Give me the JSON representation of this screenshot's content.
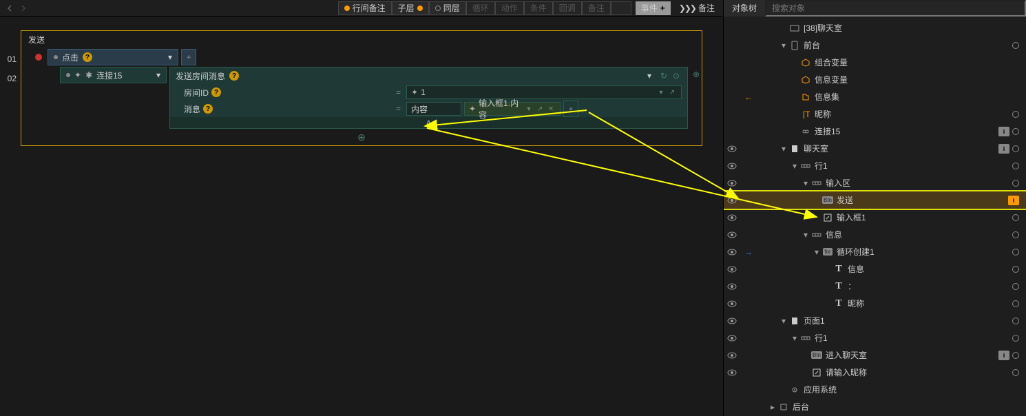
{
  "topbar": {
    "line_remark": "行间备注",
    "child_layer": "子层",
    "same_layer": "同层",
    "filters": [
      "循环",
      "动作",
      "条件",
      "回调",
      "备注"
    ],
    "event": "事件",
    "remark": "备注"
  },
  "event": {
    "title": "发送",
    "line1": "01",
    "line2": "02",
    "trigger": "点击",
    "connect": "连接15",
    "action": "发送房间消息",
    "param1_label": "房间ID",
    "param1_val": "1",
    "param2_label": "消息",
    "param2_val": "内容",
    "param2_expr": "输入框1.内容"
  },
  "tree": {
    "title": "对象树",
    "search_ph": "搜索对象",
    "items": [
      {
        "d": 2,
        "icon": "scene",
        "label": "[38]聊天室",
        "exp": "none"
      },
      {
        "d": 2,
        "icon": "phone",
        "label": "前台",
        "exp": "down",
        "circ": true
      },
      {
        "d": 3,
        "icon": "box",
        "label": "组合变量",
        "orange": true
      },
      {
        "d": 3,
        "icon": "box",
        "label": "信息变量",
        "orange": true
      },
      {
        "d": 3,
        "icon": "data",
        "label": "信息集",
        "orange": true,
        "arrow": "left"
      },
      {
        "d": 3,
        "icon": "text",
        "label": "昵称",
        "orange": true,
        "circ": true
      },
      {
        "d": 3,
        "icon": "link",
        "label": "连接15",
        "badge": "grey",
        "circ": true
      },
      {
        "d": 2,
        "icon": "page",
        "label": "聊天室",
        "exp": "down",
        "eye": true,
        "badge": "grey",
        "circ": true
      },
      {
        "d": 3,
        "icon": "row",
        "label": "行1",
        "exp": "down",
        "eye": true,
        "circ": true
      },
      {
        "d": 4,
        "icon": "row",
        "label": "输入区",
        "exp": "down",
        "eye": true,
        "circ": true
      },
      {
        "d": 5,
        "icon": "btn",
        "label": "发送",
        "eye": true,
        "badge": "orange",
        "sel": true
      },
      {
        "d": 5,
        "icon": "edit",
        "label": "输入框1",
        "eye": true,
        "circ": true
      },
      {
        "d": 4,
        "icon": "row",
        "label": "信息",
        "exp": "down",
        "eye": true,
        "circ": true
      },
      {
        "d": 5,
        "icon": "for",
        "label": "循环创建1",
        "exp": "down",
        "eye": true,
        "arrow": "right",
        "circ": true
      },
      {
        "d": 6,
        "icon": "T",
        "label": "信息",
        "eye": true,
        "circ": true
      },
      {
        "d": 6,
        "icon": "T",
        "label": "：",
        "eye": true,
        "circ": true
      },
      {
        "d": 6,
        "icon": "T",
        "label": "昵称",
        "eye": true,
        "circ": true
      },
      {
        "d": 2,
        "icon": "page",
        "label": "页面1",
        "exp": "down",
        "eye": true,
        "circ": true
      },
      {
        "d": 3,
        "icon": "row",
        "label": "行1",
        "exp": "down",
        "eye": true,
        "circ": true
      },
      {
        "d": 4,
        "icon": "btn",
        "label": "进入聊天室",
        "eye": true,
        "badge": "grey",
        "circ": true
      },
      {
        "d": 4,
        "icon": "edit",
        "label": "请输入昵称",
        "eye": true,
        "circ": true
      },
      {
        "d": 2,
        "icon": "gear",
        "label": "应用系统"
      },
      {
        "d": 1,
        "icon": "back",
        "label": "后台",
        "exp": "right"
      }
    ]
  }
}
